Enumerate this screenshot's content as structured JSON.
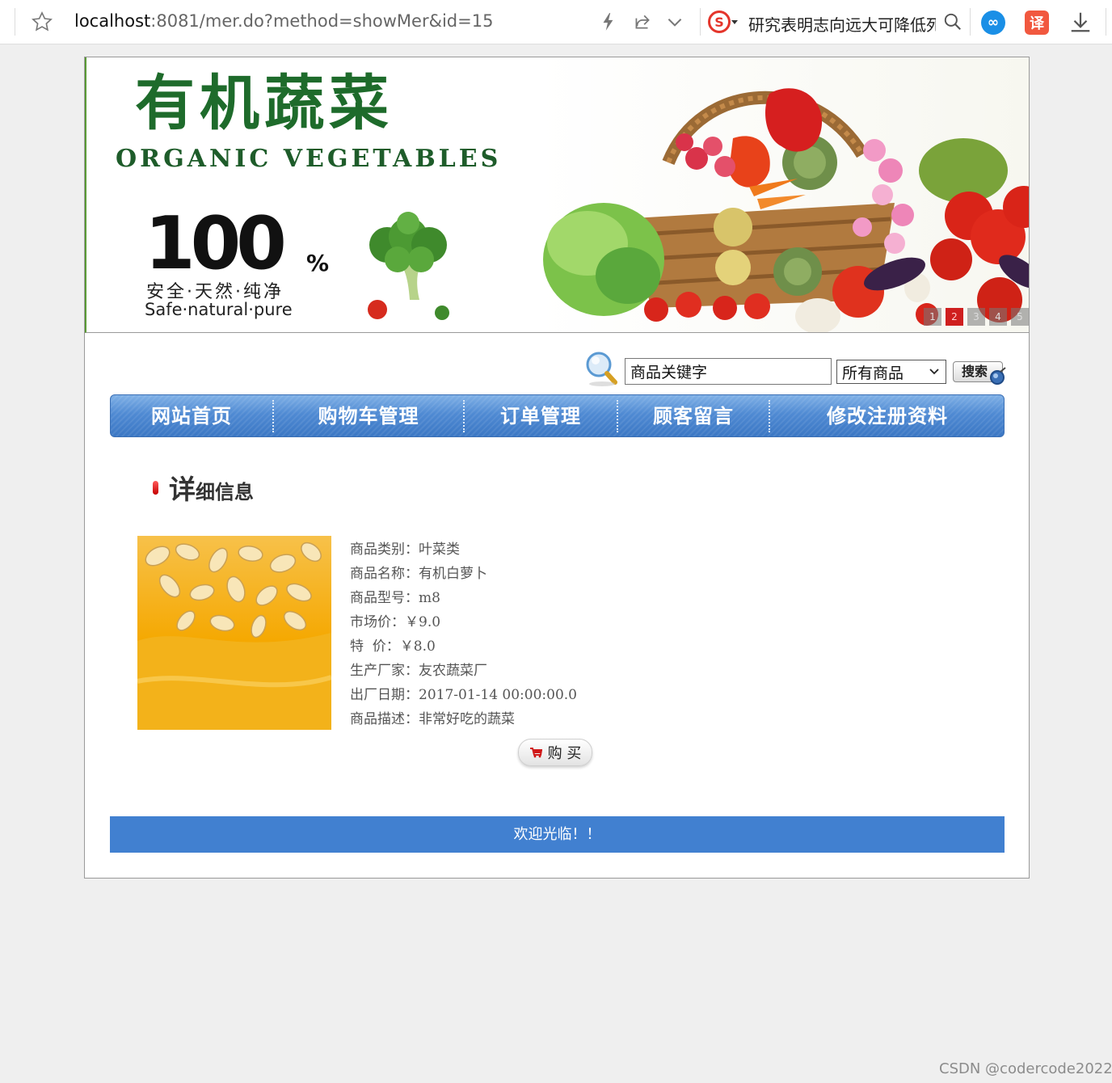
{
  "browser": {
    "url_host": "localhost",
    "url_rest": ":8081/mer.do?method=showMer&id=15",
    "search_suggestion": "研究表明志向远大可降低死",
    "engine_letter": "S",
    "ext_infinity_glyph": "∞",
    "ext_translate_glyph": "译"
  },
  "banner": {
    "brand_cn": "有机蔬菜",
    "brand_en": "ORGANIC VEGETABLES",
    "big_number": "100",
    "percent": "%",
    "safe_cn": "安全·天然·纯净",
    "safe_en": "Safe·natural·pure",
    "slide_numbers": [
      "1",
      "2",
      "3",
      "4",
      "5"
    ],
    "active_slide": 2
  },
  "search": {
    "input_value": "商品关键字",
    "category_selected": "所有商品",
    "button_label": "搜索"
  },
  "nav": {
    "items": [
      {
        "label": "网站首页"
      },
      {
        "label": "购物车管理"
      },
      {
        "label": "订单管理"
      },
      {
        "label": "顾客留言"
      },
      {
        "label": "修改注册资料"
      }
    ]
  },
  "detail": {
    "title_big": "详",
    "title_small": "细信息",
    "fields": [
      {
        "label": "商品类别：",
        "value": "叶菜类"
      },
      {
        "label": "商品名称：",
        "value": "有机白萝卜"
      },
      {
        "label": "商品型号：",
        "value": "m8"
      },
      {
        "label": "市场价：",
        "value": "￥9.0"
      },
      {
        "label": "特  价：",
        "value": "￥8.0"
      },
      {
        "label": "生产厂家：",
        "value": "友农蔬菜厂"
      },
      {
        "label": "出厂日期：",
        "value": "2017-01-14 00:00:00.0"
      },
      {
        "label": "商品描述：",
        "value": "非常好吃的蔬菜"
      }
    ],
    "buy_label": "购 买"
  },
  "footer": {
    "text": "欢迎光临！！"
  },
  "watermark": "CSDN @codercode2022",
  "colors": {
    "nav_blue": "#4f8ad3",
    "footer_blue": "#4180d0",
    "brand_green": "#1e6b2b",
    "active_slide_red": "#cf1f1f"
  }
}
